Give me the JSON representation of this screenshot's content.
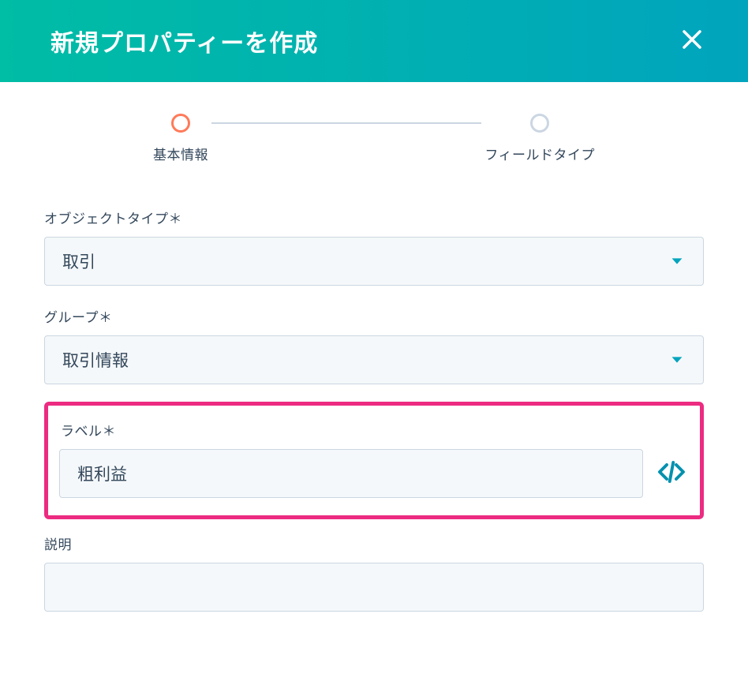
{
  "header": {
    "title": "新規プロパティーを作成"
  },
  "stepper": {
    "step1_label": "基本情報",
    "step2_label": "フィールドタイプ"
  },
  "form": {
    "object_type": {
      "label": "オブジェクトタイプ＊",
      "value": "取引"
    },
    "group": {
      "label": "グループ＊",
      "value": "取引情報"
    },
    "label_field": {
      "label": "ラベル＊",
      "value": "粗利益"
    },
    "description": {
      "label": "説明",
      "value": ""
    }
  }
}
